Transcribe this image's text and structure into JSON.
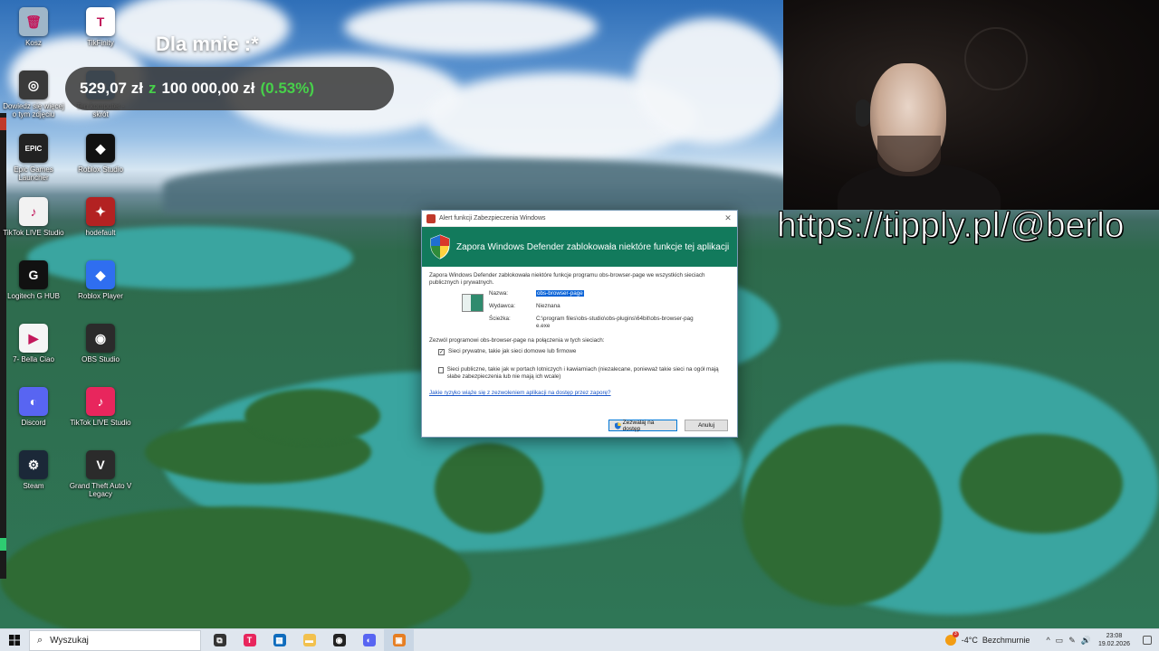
{
  "desktop_icons": [
    {
      "label": "Kosz",
      "icon": "recycle-bin-icon",
      "color": "#9fb6c8",
      "glyph": "🗑"
    },
    {
      "label": "TikFinity",
      "icon": "tikfinity-icon",
      "color": "#ffffff",
      "glyph": "T"
    },
    {
      "label": "Dowiedz się więcej o tym zdjęciu",
      "icon": "camera-info-icon",
      "color": "#3a3a3a",
      "glyph": "◎"
    },
    {
      "label": "Ten komputer - skrót",
      "icon": "this-pc-icon",
      "color": "#3c8fd6",
      "glyph": "▭"
    },
    {
      "label": "Epic Games Launcher",
      "icon": "epic-games-icon",
      "color": "#222222",
      "glyph": "EPIC"
    },
    {
      "label": "Roblox Studio",
      "icon": "roblox-studio-icon",
      "color": "#111111",
      "glyph": "◆"
    },
    {
      "label": "TikTok LIVE Studio",
      "icon": "tiktok-live-studio-icon",
      "color": "#f2f2f2",
      "glyph": "♪"
    },
    {
      "label": "hodefault",
      "icon": "hodefault-icon",
      "color": "#b32222",
      "glyph": "✦"
    },
    {
      "label": "Logitech G HUB",
      "icon": "logitech-ghub-icon",
      "color": "#111111",
      "glyph": "G"
    },
    {
      "label": "Roblox Player",
      "icon": "roblox-player-icon",
      "color": "#2f6ef0",
      "glyph": "◆"
    },
    {
      "label": "7- Bella Ciao",
      "icon": "media-file-icon",
      "color": "#f5f5f5",
      "glyph": "▶"
    },
    {
      "label": "OBS Studio",
      "icon": "obs-studio-icon",
      "color": "#2b2b2b",
      "glyph": "◉"
    },
    {
      "label": "Discord",
      "icon": "discord-icon",
      "color": "#5865f2",
      "glyph": "◐"
    },
    {
      "label": "TikTok LIVE Studio",
      "icon": "tiktok-live-studio-icon",
      "color": "#e8265d",
      "glyph": "♪"
    },
    {
      "label": "Steam",
      "icon": "steam-icon",
      "color": "#1b2838",
      "glyph": "⚙"
    },
    {
      "label": "Grand Theft Auto V Legacy",
      "icon": "gta5-icon",
      "color": "#2b2b2b",
      "glyph": "V"
    }
  ],
  "donation": {
    "title": "Dla mnie :*",
    "current": "529,07 zł",
    "separator": "z",
    "goal": "100 000,00 zł",
    "percent": "(0.53%)",
    "progress_fraction": 0.0053
  },
  "overlay_url": "https://tipply.pl/@berlo",
  "dialog": {
    "title": "Alert funkcji Zabezpieczenia Windows",
    "header": "Zapora Windows Defender zablokowała niektóre funkcje tej aplikacji",
    "intro": "Zapora Windows Defender zablokowała niektóre funkcje programu obs-browser-page we wszystkich sieciach publicznych i prywatnych.",
    "name_label": "Nazwa:",
    "name_value": "obs-browser-page",
    "publisher_label": "Wydawca:",
    "publisher_value": "Nieznana",
    "path_label": "Ścieżka:",
    "path_value": "C:\\program files\\obs-studio\\obs-plugins\\64bit\\obs-browser-page.exe",
    "allow_prompt": "Zezwól programowi obs-browser-page na połączenia w tych sieciach:",
    "private_label": "Sieci prywatne, takie jak sieci domowe lub firmowe",
    "private_checked": true,
    "public_label": "Sieci publiczne, takie jak w portach lotniczych i kawiarniach (niezalecane, ponieważ takie sieci na ogół mają słabe zabezpieczenia lub nie mają ich wcale)",
    "public_checked": false,
    "risk_link": "Jakie ryzyko wiąże się z zezwoleniem aplikacji na dostęp przez zaporę?",
    "allow_button": "Zezwalaj na dostęp",
    "cancel_button": "Anuluj",
    "close_glyph": "✕"
  },
  "taskbar": {
    "search_placeholder": "Wyszukaj",
    "apps": [
      {
        "name": "task-view",
        "glyph": "⧉",
        "color": "#333333"
      },
      {
        "name": "tikfinity",
        "glyph": "T",
        "color": "#e8265d"
      },
      {
        "name": "microsoft-store",
        "glyph": "▦",
        "color": "#0f6cbd"
      },
      {
        "name": "file-explorer",
        "glyph": "▬",
        "color": "#f2c14e"
      },
      {
        "name": "obs-studio",
        "glyph": "◉",
        "color": "#222222"
      },
      {
        "name": "discord",
        "glyph": "◐",
        "color": "#5865f2"
      },
      {
        "name": "package-app",
        "glyph": "▣",
        "color": "#e67e22"
      }
    ],
    "weather_badge": "3",
    "temperature": "-4°C",
    "weather_desc": "Bezchmurnie",
    "tray_icons": [
      "^",
      "▭",
      "✎",
      "🔊"
    ],
    "time": "23:08",
    "date": "19.02.2026"
  }
}
